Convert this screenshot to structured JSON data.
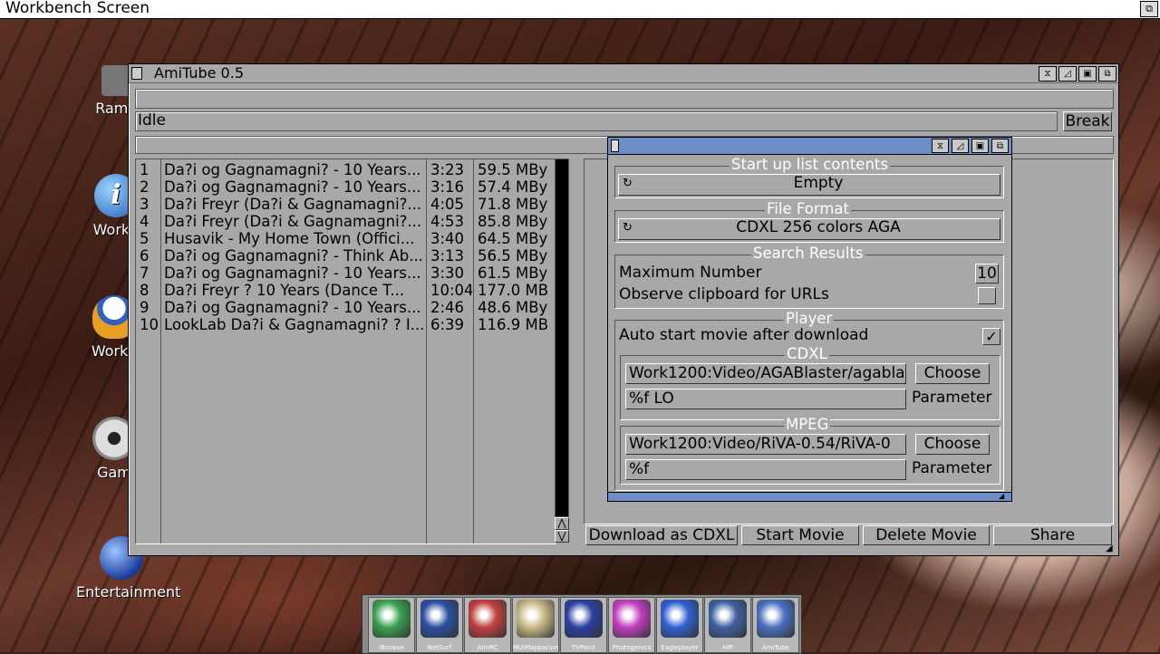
{
  "screen": {
    "title": "Workbench Screen"
  },
  "desktop_icons": [
    {
      "label": "Ram D",
      "color": "#777777"
    },
    {
      "label": "Workb",
      "color": "#3a7fd0"
    },
    {
      "label": "WorkT",
      "color": "#e8a020"
    },
    {
      "label": "Gam",
      "color": "#dddddd"
    },
    {
      "label": "Entertainment",
      "color": "#2a5cc0"
    }
  ],
  "window": {
    "title": "AmiTube 0.5",
    "status": "Idle",
    "break_label": "Break",
    "results": [
      {
        "num": "1",
        "title": "Da?i og Gagnamagni? - 10 Years...",
        "time": "3:23",
        "size": "59.5 MBy"
      },
      {
        "num": "2",
        "title": "Da?i og Gagnamagni? - 10 Years...",
        "time": "3:16",
        "size": "57.4 MBy"
      },
      {
        "num": "3",
        "title": "Da?i Freyr (Da?i & Gagnamagni?...",
        "time": "4:05",
        "size": "71.8 MBy"
      },
      {
        "num": "4",
        "title": "Da?i Freyr (Da?i & Gagnamagni?...",
        "time": "4:53",
        "size": "85.8 MBy"
      },
      {
        "num": "5",
        "title": "Husavik - My Home Town (Offici...",
        "time": "3:40",
        "size": "64.5 MBy"
      },
      {
        "num": "6",
        "title": "Da?i og Gagnamagni? - Think Ab...",
        "time": "3:13",
        "size": "56.5 MBy"
      },
      {
        "num": "7",
        "title": "Da?i og Gagnamagni? - 10 Years...",
        "time": "3:30",
        "size": "61.5 MBy"
      },
      {
        "num": "8",
        "title": "Da?i Freyr ? 10 Years (Dance T...",
        "time": "10:04",
        "size": "177.0 MB"
      },
      {
        "num": "9",
        "title": "Da?i og Gagnamagni? - 10 Years...",
        "time": "2:46",
        "size": "48.6 MBy"
      },
      {
        "num": "10",
        "title": "LookLab Da?i & Gagnamagni? ? I...",
        "time": "6:39",
        "size": "116.9 MB"
      }
    ],
    "buttons": {
      "download": "Download as CDXL",
      "start": "Start Movie",
      "delete": "Delete Movie",
      "share": "Share"
    }
  },
  "settings": {
    "startup_group": "Start up list contents",
    "startup_value": "Empty",
    "format_group": "File Format",
    "format_value": "CDXL 256 colors AGA",
    "search_group": "Search Results",
    "max_number_label": "Maximum Number",
    "max_number_value": "10",
    "observe_label": "Observe clipboard for URLs",
    "player_group": "Player",
    "autostart_label": "Auto start movie after download",
    "cdxl_group": "CDXL",
    "cdxl_path": "Work1200:Video/AGABlaster/agabla",
    "cdxl_param": "%f LO",
    "mpeg_group": "MPEG",
    "mpeg_path": "Work1200:Video/RiVA-0.54/RiVA-0",
    "mpeg_param": "%f",
    "choose_label": "Choose",
    "parameter_label": "Parameter"
  },
  "dock": [
    {
      "label": "IBrowse",
      "color": "#3aa050"
    },
    {
      "label": "NetSurf",
      "color": "#2a4fa0"
    },
    {
      "label": "AmIRC",
      "color": "#c04040"
    },
    {
      "label": "MUIMapparium",
      "color": "#c8b888"
    },
    {
      "label": "TVPaint",
      "color": "#2a3fa0"
    },
    {
      "label": "Photogenics",
      "color": "#c040c0"
    },
    {
      "label": "Eagleplayer",
      "color": "#3060d0"
    },
    {
      "label": "HIP",
      "color": "#4060a0"
    },
    {
      "label": "AmiTube",
      "color": "#4a70c0"
    }
  ]
}
